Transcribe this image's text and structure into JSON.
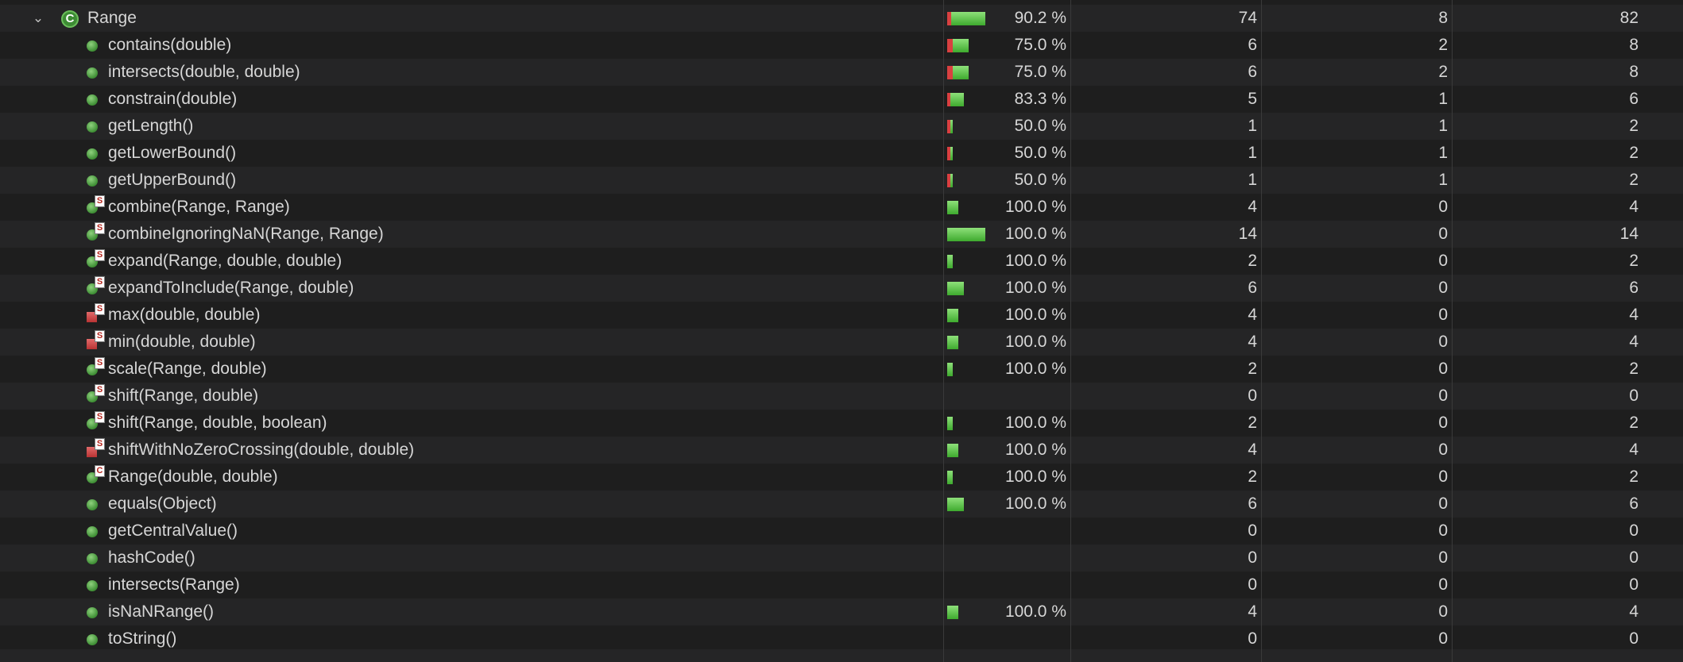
{
  "top_partial_row": {
    "percent": "",
    "covered": "",
    "missed": "",
    "total": ""
  },
  "class_row": {
    "name": "Range",
    "class_icon_letter": "C",
    "icon": "chevron-down-icon",
    "coverage_fraction": 0.902,
    "percent": "90.2 %",
    "covered": "74",
    "missed": "8",
    "total": "82"
  },
  "methods": [
    {
      "name": "contains(double)",
      "kind": "public",
      "badge": "",
      "coverage_fraction": 0.75,
      "percent": "75.0 %",
      "covered": "6",
      "missed": "2",
      "total": "8"
    },
    {
      "name": "intersects(double, double)",
      "kind": "public",
      "badge": "",
      "coverage_fraction": 0.75,
      "percent": "75.0 %",
      "covered": "6",
      "missed": "2",
      "total": "8"
    },
    {
      "name": "constrain(double)",
      "kind": "public",
      "badge": "",
      "coverage_fraction": 0.833,
      "percent": "83.3 %",
      "covered": "5",
      "missed": "1",
      "total": "6"
    },
    {
      "name": "getLength()",
      "kind": "public",
      "badge": "",
      "coverage_fraction": 0.5,
      "percent": "50.0 %",
      "covered": "1",
      "missed": "1",
      "total": "2"
    },
    {
      "name": "getLowerBound()",
      "kind": "public",
      "badge": "",
      "coverage_fraction": 0.5,
      "percent": "50.0 %",
      "covered": "1",
      "missed": "1",
      "total": "2"
    },
    {
      "name": "getUpperBound()",
      "kind": "public",
      "badge": "",
      "coverage_fraction": 0.5,
      "percent": "50.0 %",
      "covered": "1",
      "missed": "1",
      "total": "2"
    },
    {
      "name": "combine(Range, Range)",
      "kind": "public",
      "badge": "S",
      "coverage_fraction": 1.0,
      "percent": "100.0 %",
      "covered": "4",
      "missed": "0",
      "total": "4"
    },
    {
      "name": "combineIgnoringNaN(Range, Range)",
      "kind": "public",
      "badge": "S",
      "coverage_fraction": 1.0,
      "percent": "100.0 %",
      "covered": "14",
      "missed": "0",
      "total": "14"
    },
    {
      "name": "expand(Range, double, double)",
      "kind": "public",
      "badge": "S",
      "coverage_fraction": 1.0,
      "percent": "100.0 %",
      "covered": "2",
      "missed": "0",
      "total": "2"
    },
    {
      "name": "expandToInclude(Range, double)",
      "kind": "public",
      "badge": "S",
      "coverage_fraction": 1.0,
      "percent": "100.0 %",
      "covered": "6",
      "missed": "0",
      "total": "6"
    },
    {
      "name": "max(double, double)",
      "kind": "private",
      "badge": "S",
      "coverage_fraction": 1.0,
      "percent": "100.0 %",
      "covered": "4",
      "missed": "0",
      "total": "4"
    },
    {
      "name": "min(double, double)",
      "kind": "private",
      "badge": "S",
      "coverage_fraction": 1.0,
      "percent": "100.0 %",
      "covered": "4",
      "missed": "0",
      "total": "4"
    },
    {
      "name": "scale(Range, double)",
      "kind": "public",
      "badge": "S",
      "coverage_fraction": 1.0,
      "percent": "100.0 %",
      "covered": "2",
      "missed": "0",
      "total": "2"
    },
    {
      "name": "shift(Range, double)",
      "kind": "public",
      "badge": "S",
      "coverage_fraction": null,
      "percent": "",
      "covered": "0",
      "missed": "0",
      "total": "0"
    },
    {
      "name": "shift(Range, double, boolean)",
      "kind": "public",
      "badge": "S",
      "coverage_fraction": 1.0,
      "percent": "100.0 %",
      "covered": "2",
      "missed": "0",
      "total": "2"
    },
    {
      "name": "shiftWithNoZeroCrossing(double, double)",
      "kind": "private",
      "badge": "S",
      "coverage_fraction": 1.0,
      "percent": "100.0 %",
      "covered": "4",
      "missed": "0",
      "total": "4"
    },
    {
      "name": "Range(double, double)",
      "kind": "public",
      "badge": "C",
      "coverage_fraction": 1.0,
      "percent": "100.0 %",
      "covered": "2",
      "missed": "0",
      "total": "2"
    },
    {
      "name": "equals(Object)",
      "kind": "public",
      "badge": "",
      "coverage_fraction": 1.0,
      "percent": "100.0 %",
      "covered": "6",
      "missed": "0",
      "total": "6"
    },
    {
      "name": "getCentralValue()",
      "kind": "public",
      "badge": "",
      "coverage_fraction": null,
      "percent": "",
      "covered": "0",
      "missed": "0",
      "total": "0"
    },
    {
      "name": "hashCode()",
      "kind": "public",
      "badge": "",
      "coverage_fraction": null,
      "percent": "",
      "covered": "0",
      "missed": "0",
      "total": "0"
    },
    {
      "name": "intersects(Range)",
      "kind": "public",
      "badge": "",
      "coverage_fraction": null,
      "percent": "",
      "covered": "0",
      "missed": "0",
      "total": "0"
    },
    {
      "name": "isNaNRange()",
      "kind": "public",
      "badge": "",
      "coverage_fraction": 1.0,
      "percent": "100.0 %",
      "covered": "4",
      "missed": "0",
      "total": "4"
    },
    {
      "name": "toString()",
      "kind": "public",
      "badge": "",
      "coverage_fraction": null,
      "percent": "",
      "covered": "0",
      "missed": "0",
      "total": "0"
    }
  ],
  "colors": {
    "background": "#1e1e1e",
    "row_alt": "#252526",
    "covered_bar": "#4cb63a",
    "missed_bar": "#d94040",
    "text": "#d6d6d6"
  }
}
